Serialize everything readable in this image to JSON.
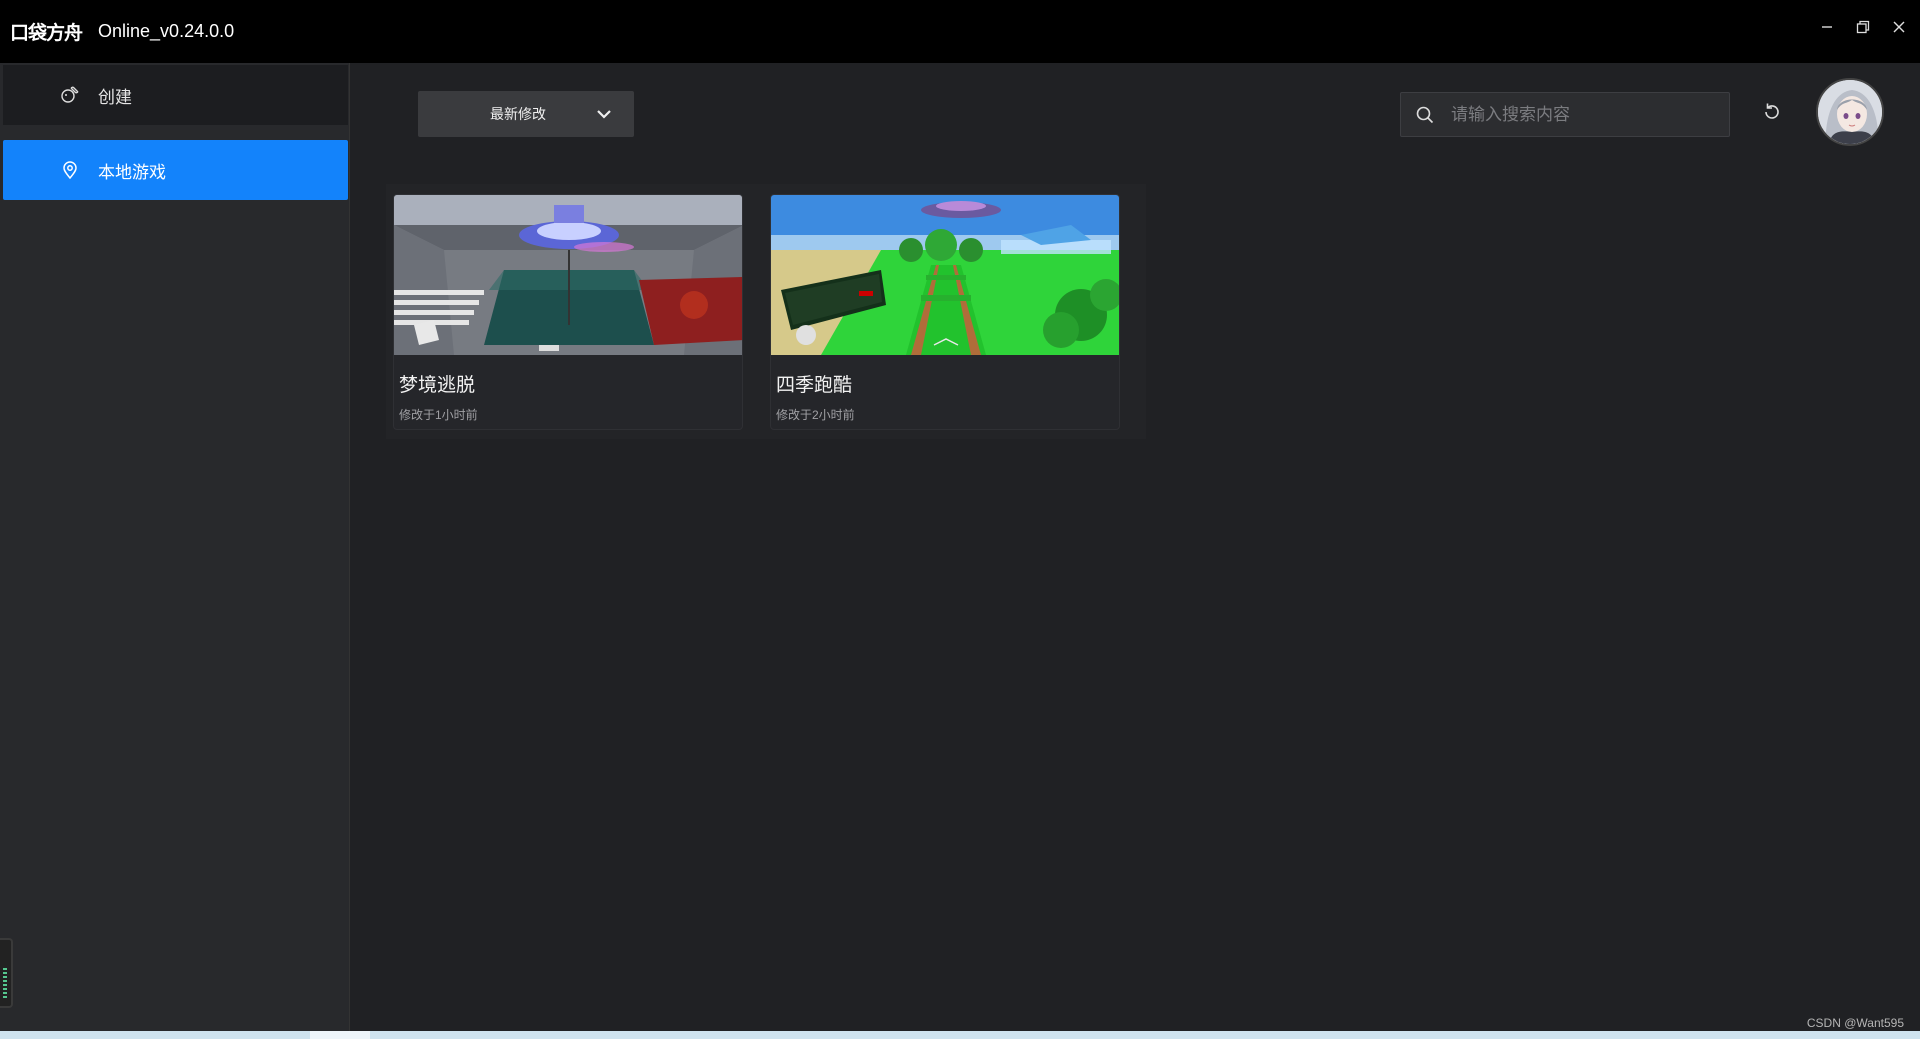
{
  "titlebar": {
    "logo_text": "口袋方舟",
    "title": "Online_v0.24.0.0",
    "controls": [
      "minimize-icon",
      "restore-icon",
      "close-icon"
    ]
  },
  "sidebar": {
    "items": [
      {
        "label": "创建",
        "icon": "create-icon",
        "active": false
      },
      {
        "label": "本地游戏",
        "icon": "location-pin-icon",
        "active": true
      }
    ]
  },
  "toolbar": {
    "sort_selected": "最新修改",
    "search_placeholder": "请输入搜索内容"
  },
  "games": [
    {
      "title": "梦境逃脱",
      "modified": "修改于1小时前"
    },
    {
      "title": "四季跑酷",
      "modified": "修改于2小时前"
    }
  ],
  "footer": {
    "watermark": "CSDN @Want595"
  },
  "colors": {
    "accent": "#1383fb",
    "titlebar": "#000000",
    "sidebar": "#28292c",
    "main": "#202124"
  }
}
